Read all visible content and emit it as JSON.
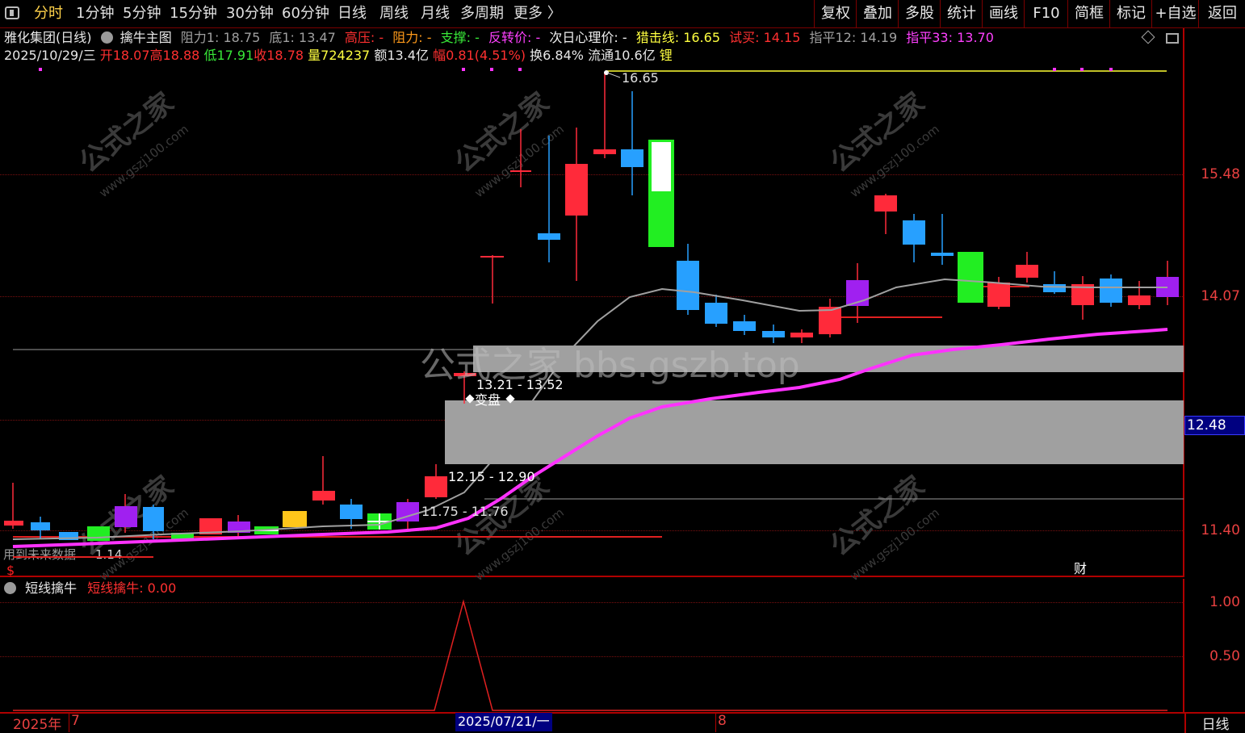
{
  "topbar": {
    "periods": [
      "分时",
      "1分钟",
      "5分钟",
      "15分钟",
      "30分钟",
      "60分钟",
      "日线",
      "周线",
      "月线",
      "多周期",
      "更多 〉"
    ],
    "active_index": 0,
    "tools": [
      "复权",
      "叠加",
      "多股",
      "统计",
      "画线",
      "F10",
      "简框",
      "标记",
      "+自选",
      "返回"
    ]
  },
  "info1": {
    "stock": "雅化集团(日线)",
    "indicator": "擒牛主图",
    "zl1": "阻力1: 18.75",
    "di1": "底1: 13.47",
    "gaoya": "高压: -",
    "zuli": "阻力: -",
    "zhicheng": "支撑: -",
    "fanzhuan": "反转价: -",
    "xinli": "次日心理价: -",
    "lieji": "猎击线: 16.65",
    "shimai": "试买: 14.15",
    "zhiping12": "指平12: 14.19",
    "zhiping33": "指平33: 13.70"
  },
  "info2": {
    "date": "2025/10/29/三",
    "open": "开18.07",
    "high": "高18.88",
    "low": "低17.91",
    "close": "收18.78",
    "vol": "量724237",
    "amount": "额13.4亿",
    "amp": "幅0.81(4.51%)",
    "turn": "换6.84%",
    "float": "流通10.6亿",
    "tag": "锂"
  },
  "chart": {
    "peak_label": "16.65",
    "zone1_label": "13.21 - 13.52",
    "zone2_label": "12.15 - 12.90",
    "zone3_label": "11.75 - 11.76",
    "biantan_label": "变盘",
    "watermark_text": "公式之家",
    "watermark_url": "www.gszj100.com",
    "center_watermark": "公式之家 bbs.gszb.top",
    "bottom_left_text": "用到未来数据",
    "bottom_left_value": "1.14",
    "dollar_label": "$",
    "cai_label": "财"
  },
  "axis": {
    "labels": [
      "15.48",
      "14.07",
      "11.40"
    ],
    "current": "12.48"
  },
  "sub": {
    "name": "短线擒牛",
    "value_label": "短线擒牛: 0.00",
    "axis": [
      "1.00",
      "0.50"
    ]
  },
  "bottom": {
    "year": "2025年",
    "m7": "7",
    "cursor_date": "2025/07/21/一",
    "m8": "8",
    "period": "日线"
  },
  "colors": {
    "up": "#ff2a3a",
    "down": "#27a0ff",
    "magenta": "#ff32ff",
    "grey_line": "#a0a0a0",
    "yellow": "#ffff33",
    "frame": "#b00000"
  }
}
